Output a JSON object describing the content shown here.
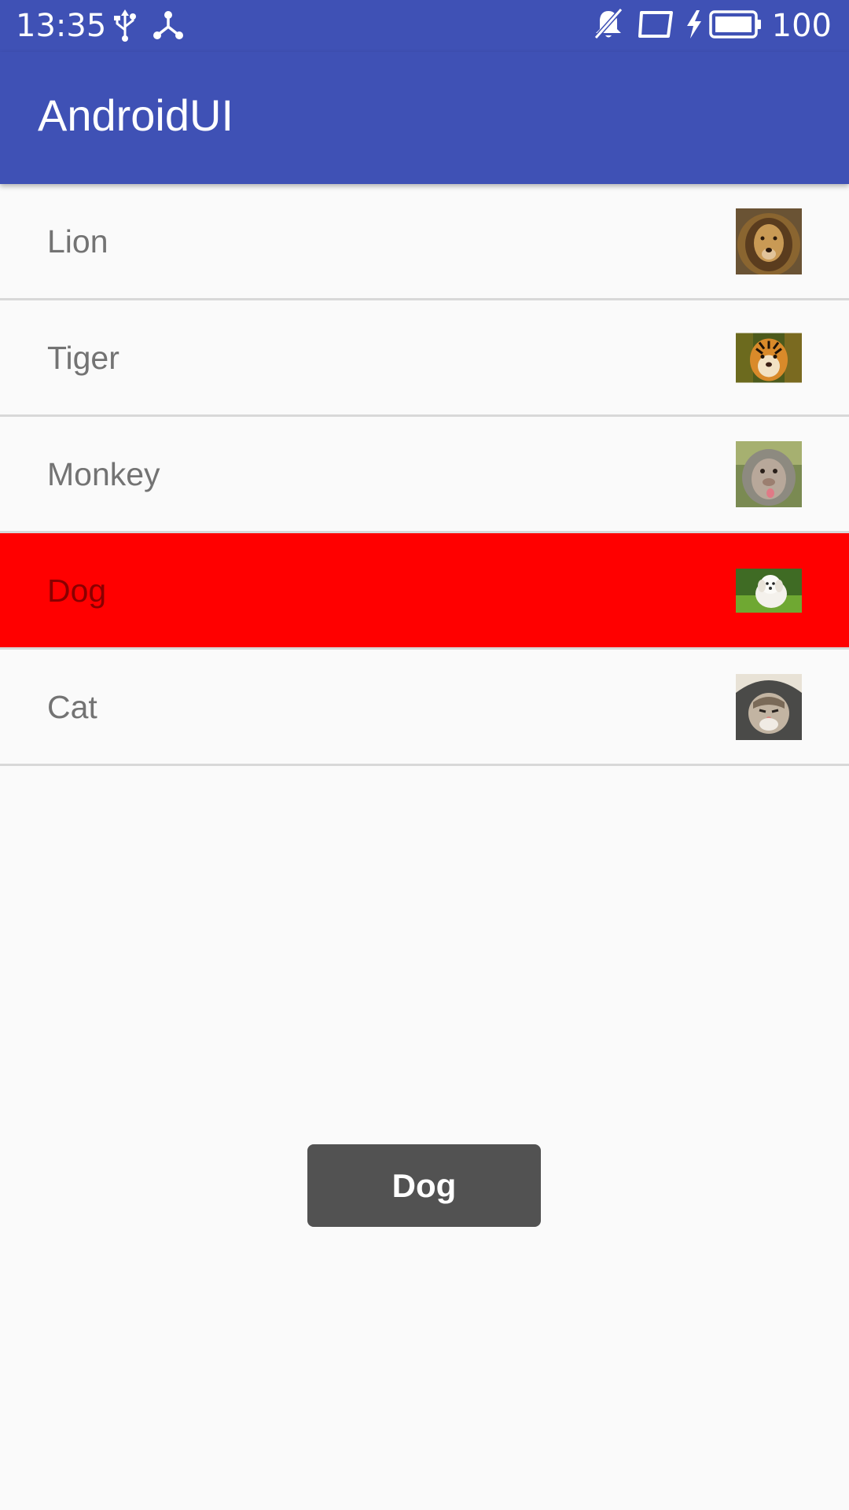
{
  "status_bar": {
    "time": "13:35",
    "battery_level": "100",
    "icons": [
      "usb-icon",
      "share-network-icon",
      "notifications-muted-icon",
      "screen-rotation-icon",
      "charging-bolt-icon",
      "battery-full-icon"
    ]
  },
  "app_bar": {
    "title": "AndroidUI",
    "color": "#3f51b5"
  },
  "list": {
    "selected_index": 3,
    "selected_color": "#ff0000",
    "items": [
      {
        "label": "Lion",
        "image": "lion-photo"
      },
      {
        "label": "Tiger",
        "image": "tiger-photo"
      },
      {
        "label": "Monkey",
        "image": "monkey-photo"
      },
      {
        "label": "Dog",
        "image": "dog-photo"
      },
      {
        "label": "Cat",
        "image": "cat-photo"
      }
    ]
  },
  "toast": {
    "text": "Dog"
  }
}
